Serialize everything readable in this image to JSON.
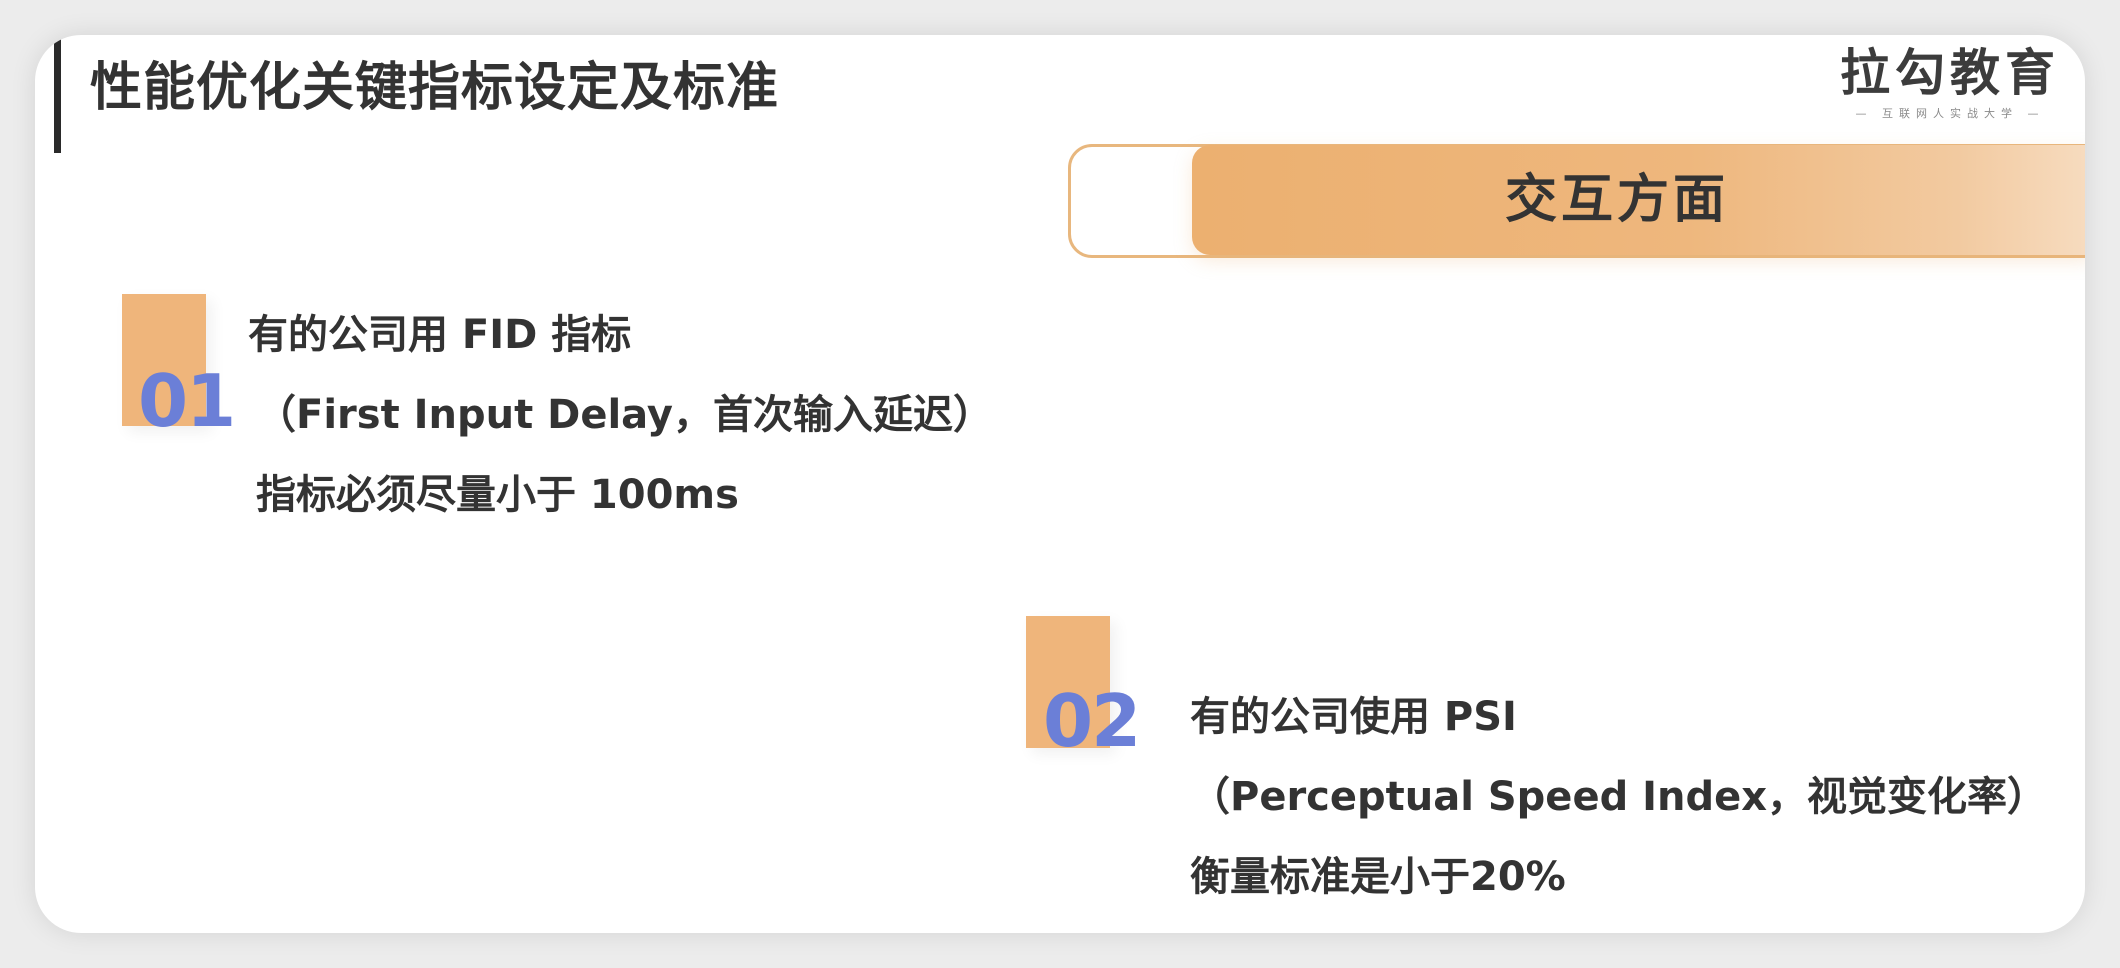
{
  "slide": {
    "title": "性能优化关键指标设定及标准",
    "logo": {
      "name": "拉勾教育",
      "tagline": "— 互联网人实战大学 —"
    },
    "section_banner": "交互方面",
    "points": [
      {
        "number": "01",
        "lines": [
          "有的公司用 FID 指标",
          "（First Input Delay，首次输入延迟）",
          "指标必须尽量小于 100ms"
        ]
      },
      {
        "number": "02",
        "lines": [
          "有的公司使用 PSI",
          "（Perceptual Speed Index，视觉变化率）",
          "衡量标准是小于20%"
        ]
      }
    ]
  },
  "colors": {
    "accent_orange": "#efb57b",
    "number_blue": "#6b7fd7",
    "text_dark": "#333333"
  }
}
